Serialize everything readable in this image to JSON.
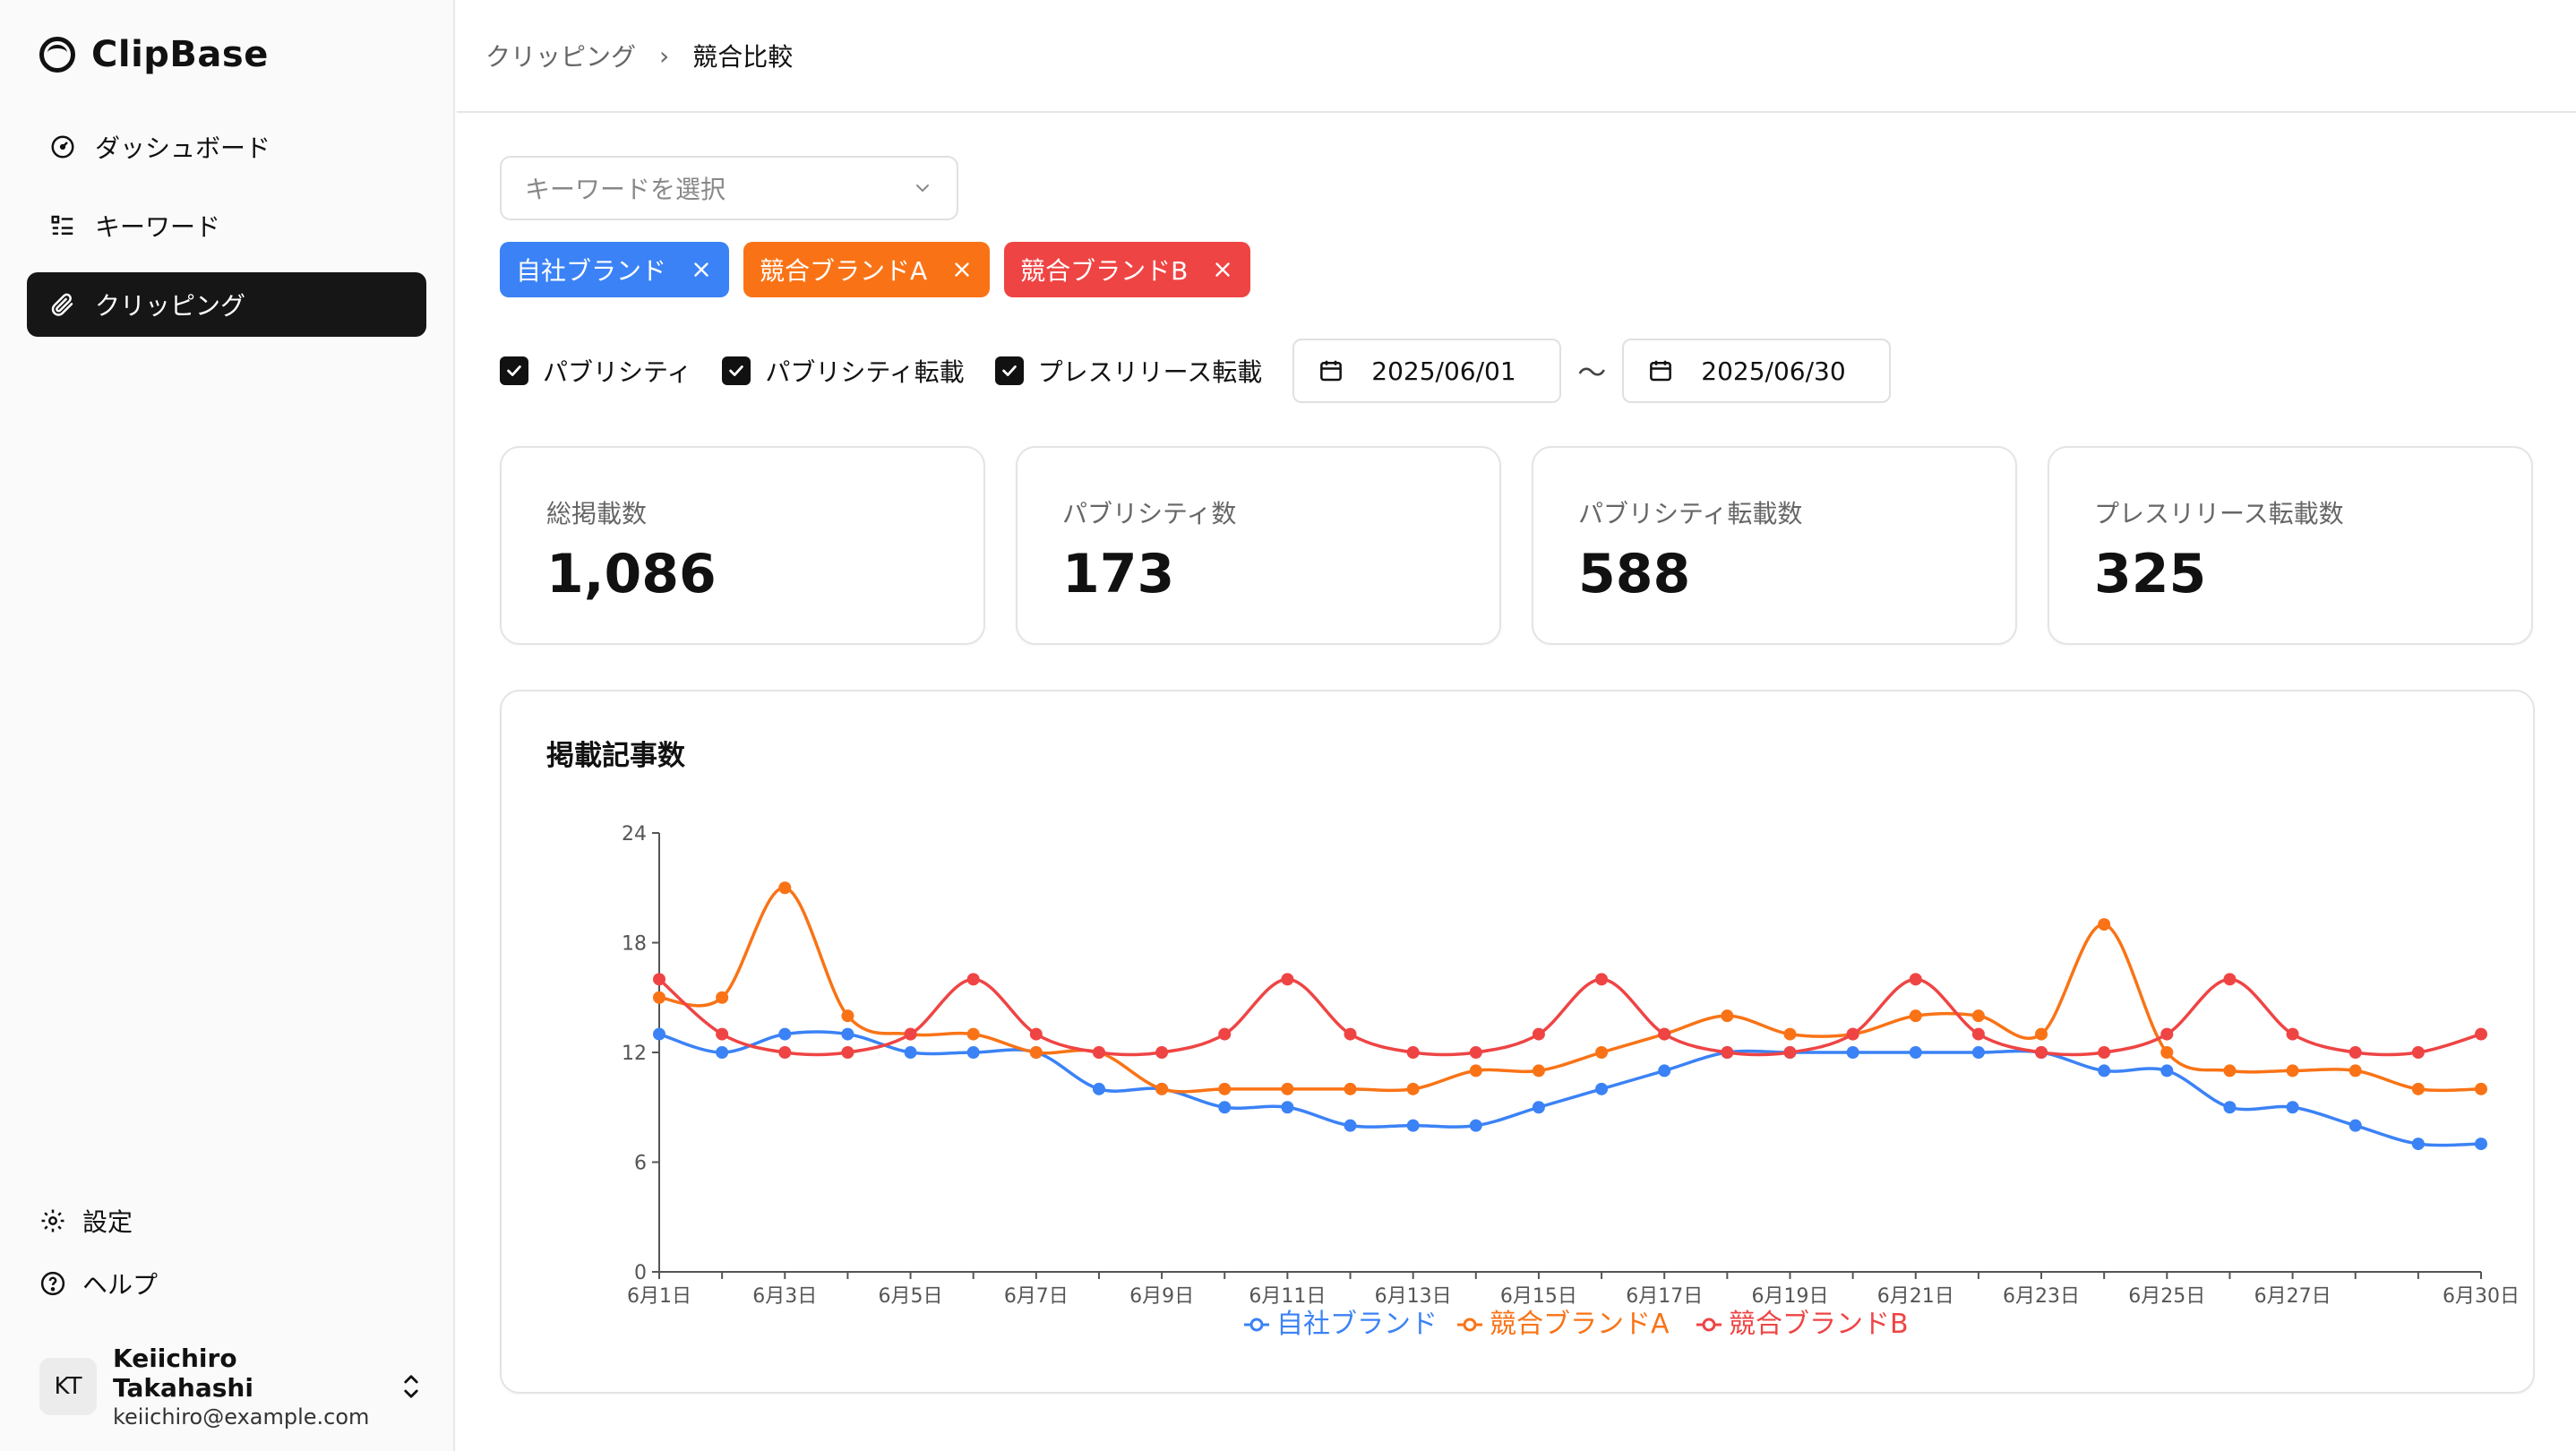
{
  "app": {
    "name": "ClipBase"
  },
  "sidebar": {
    "items": [
      {
        "label": "ダッシュボード",
        "icon": "gauge-icon"
      },
      {
        "label": "キーワード",
        "icon": "list-icon"
      },
      {
        "label": "クリッピング",
        "icon": "paperclip-icon",
        "active": true
      }
    ],
    "bottom": [
      {
        "label": "設定",
        "icon": "gear-icon"
      },
      {
        "label": "ヘルプ",
        "icon": "help-circle-icon"
      }
    ],
    "user": {
      "initials": "KT",
      "name": "Keiichiro Takahashi",
      "email": "keiichiro@example.com"
    }
  },
  "breadcrumb": {
    "parent": "クリッピング",
    "separator": "›",
    "current": "競合比較"
  },
  "filters": {
    "keyword_placeholder": "キーワードを選択",
    "chips": [
      {
        "label": "自社ブランド",
        "color": "#3b82f6"
      },
      {
        "label": "競合ブランドA",
        "color": "#f97316"
      },
      {
        "label": "競合ブランドB",
        "color": "#ef4444"
      }
    ],
    "checkboxes": [
      {
        "label": "パブリシティ",
        "checked": true
      },
      {
        "label": "パブリシティ転載",
        "checked": true
      },
      {
        "label": "プレスリリース転載",
        "checked": true
      }
    ],
    "date_from": "2025/06/01",
    "date_separator": "〜",
    "date_to": "2025/06/30"
  },
  "stats": [
    {
      "label": "総掲載数",
      "value": "1,086"
    },
    {
      "label": "パブリシティ数",
      "value": "173"
    },
    {
      "label": "パブリシティ転載数",
      "value": "588"
    },
    {
      "label": "プレスリリース転載数",
      "value": "325"
    }
  ],
  "chart_data": {
    "type": "line",
    "title": "掲載記事数",
    "xlabel": "",
    "ylabel": "",
    "ylim": [
      0,
      24
    ],
    "yticks": [
      0,
      6,
      12,
      18,
      24
    ],
    "x": [
      "6月1日",
      "6月2日",
      "6月3日",
      "6月4日",
      "6月5日",
      "6月6日",
      "6月7日",
      "6月8日",
      "6月9日",
      "6月10日",
      "6月11日",
      "6月12日",
      "6月13日",
      "6月14日",
      "6月15日",
      "6月16日",
      "6月17日",
      "6月18日",
      "6月19日",
      "6月20日",
      "6月21日",
      "6月22日",
      "6月23日",
      "6月24日",
      "6月25日",
      "6月26日",
      "6月27日",
      "6月28日",
      "6月29日",
      "6月30日"
    ],
    "xtick_labels": [
      "6月1日",
      "6月3日",
      "6月5日",
      "6月7日",
      "6月9日",
      "6月11日",
      "6月13日",
      "6月15日",
      "6月17日",
      "6月19日",
      "6月21日",
      "6月23日",
      "6月25日",
      "6月27日",
      "6月30日"
    ],
    "legend_position": "bottom-center",
    "series": [
      {
        "name": "自社ブランド",
        "color": "#3b82f6",
        "values": [
          13,
          12,
          13,
          13,
          12,
          12,
          12,
          10,
          10,
          9,
          9,
          8,
          8,
          8,
          9,
          10,
          11,
          12,
          12,
          12,
          12,
          12,
          12,
          11,
          11,
          9,
          9,
          8,
          7,
          7
        ]
      },
      {
        "name": "競合ブランドA",
        "color": "#f97316",
        "values": [
          15,
          15,
          21,
          14,
          13,
          13,
          12,
          12,
          10,
          10,
          10,
          10,
          10,
          11,
          11,
          12,
          13,
          14,
          13,
          13,
          14,
          14,
          13,
          19,
          12,
          11,
          11,
          11,
          10,
          10
        ]
      },
      {
        "name": "競合ブランドB",
        "color": "#ef4444",
        "values": [
          16,
          13,
          12,
          12,
          13,
          16,
          13,
          12,
          12,
          13,
          16,
          13,
          12,
          12,
          13,
          16,
          13,
          12,
          12,
          13,
          16,
          13,
          12,
          12,
          13,
          16,
          13,
          12,
          12,
          13
        ]
      }
    ]
  }
}
